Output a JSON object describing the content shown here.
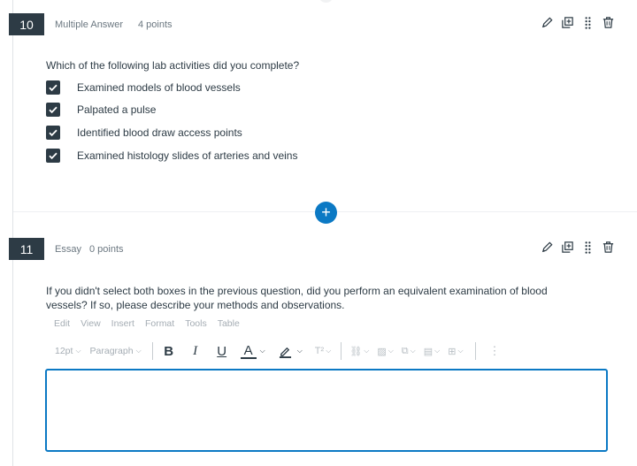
{
  "questions": [
    {
      "number": "10",
      "type": "Multiple Answer",
      "points": "4 points",
      "prompt": "Which of the following lab activities did you complete?",
      "answers": [
        {
          "label": "Examined models of blood vessels",
          "checked": true
        },
        {
          "label": "Palpated a pulse",
          "checked": true
        },
        {
          "label": "Identified blood draw access points",
          "checked": true
        },
        {
          "label": "Examined histology slides of arteries and veins",
          "checked": true
        }
      ]
    },
    {
      "number": "11",
      "type": "Essay",
      "points": "0 points",
      "prompt_line1": "If you didn't select both boxes in the previous question, did you perform an equivalent examination of blood",
      "prompt_line2": "vessels? If so, please describe your methods and observations."
    }
  ],
  "add_button": "+",
  "editor": {
    "menubar": [
      "Edit",
      "View",
      "Insert",
      "Format",
      "Tools",
      "Table"
    ],
    "font_size": "12pt",
    "block_format": "Paragraph",
    "bold": "B",
    "italic": "I",
    "underline": "U",
    "text_color": "A",
    "superscript": "T²",
    "more": "⋮",
    "value": ""
  },
  "colors": {
    "badge": "#2d3b45",
    "accent": "#0b79c4"
  },
  "icons": [
    "pencil-icon",
    "copy-icon",
    "drag-handle-icon",
    "trash-icon",
    "checkmark-icon",
    "link-icon",
    "image-icon",
    "media-icon",
    "document-icon",
    "equation-icon",
    "highlight-icon"
  ]
}
